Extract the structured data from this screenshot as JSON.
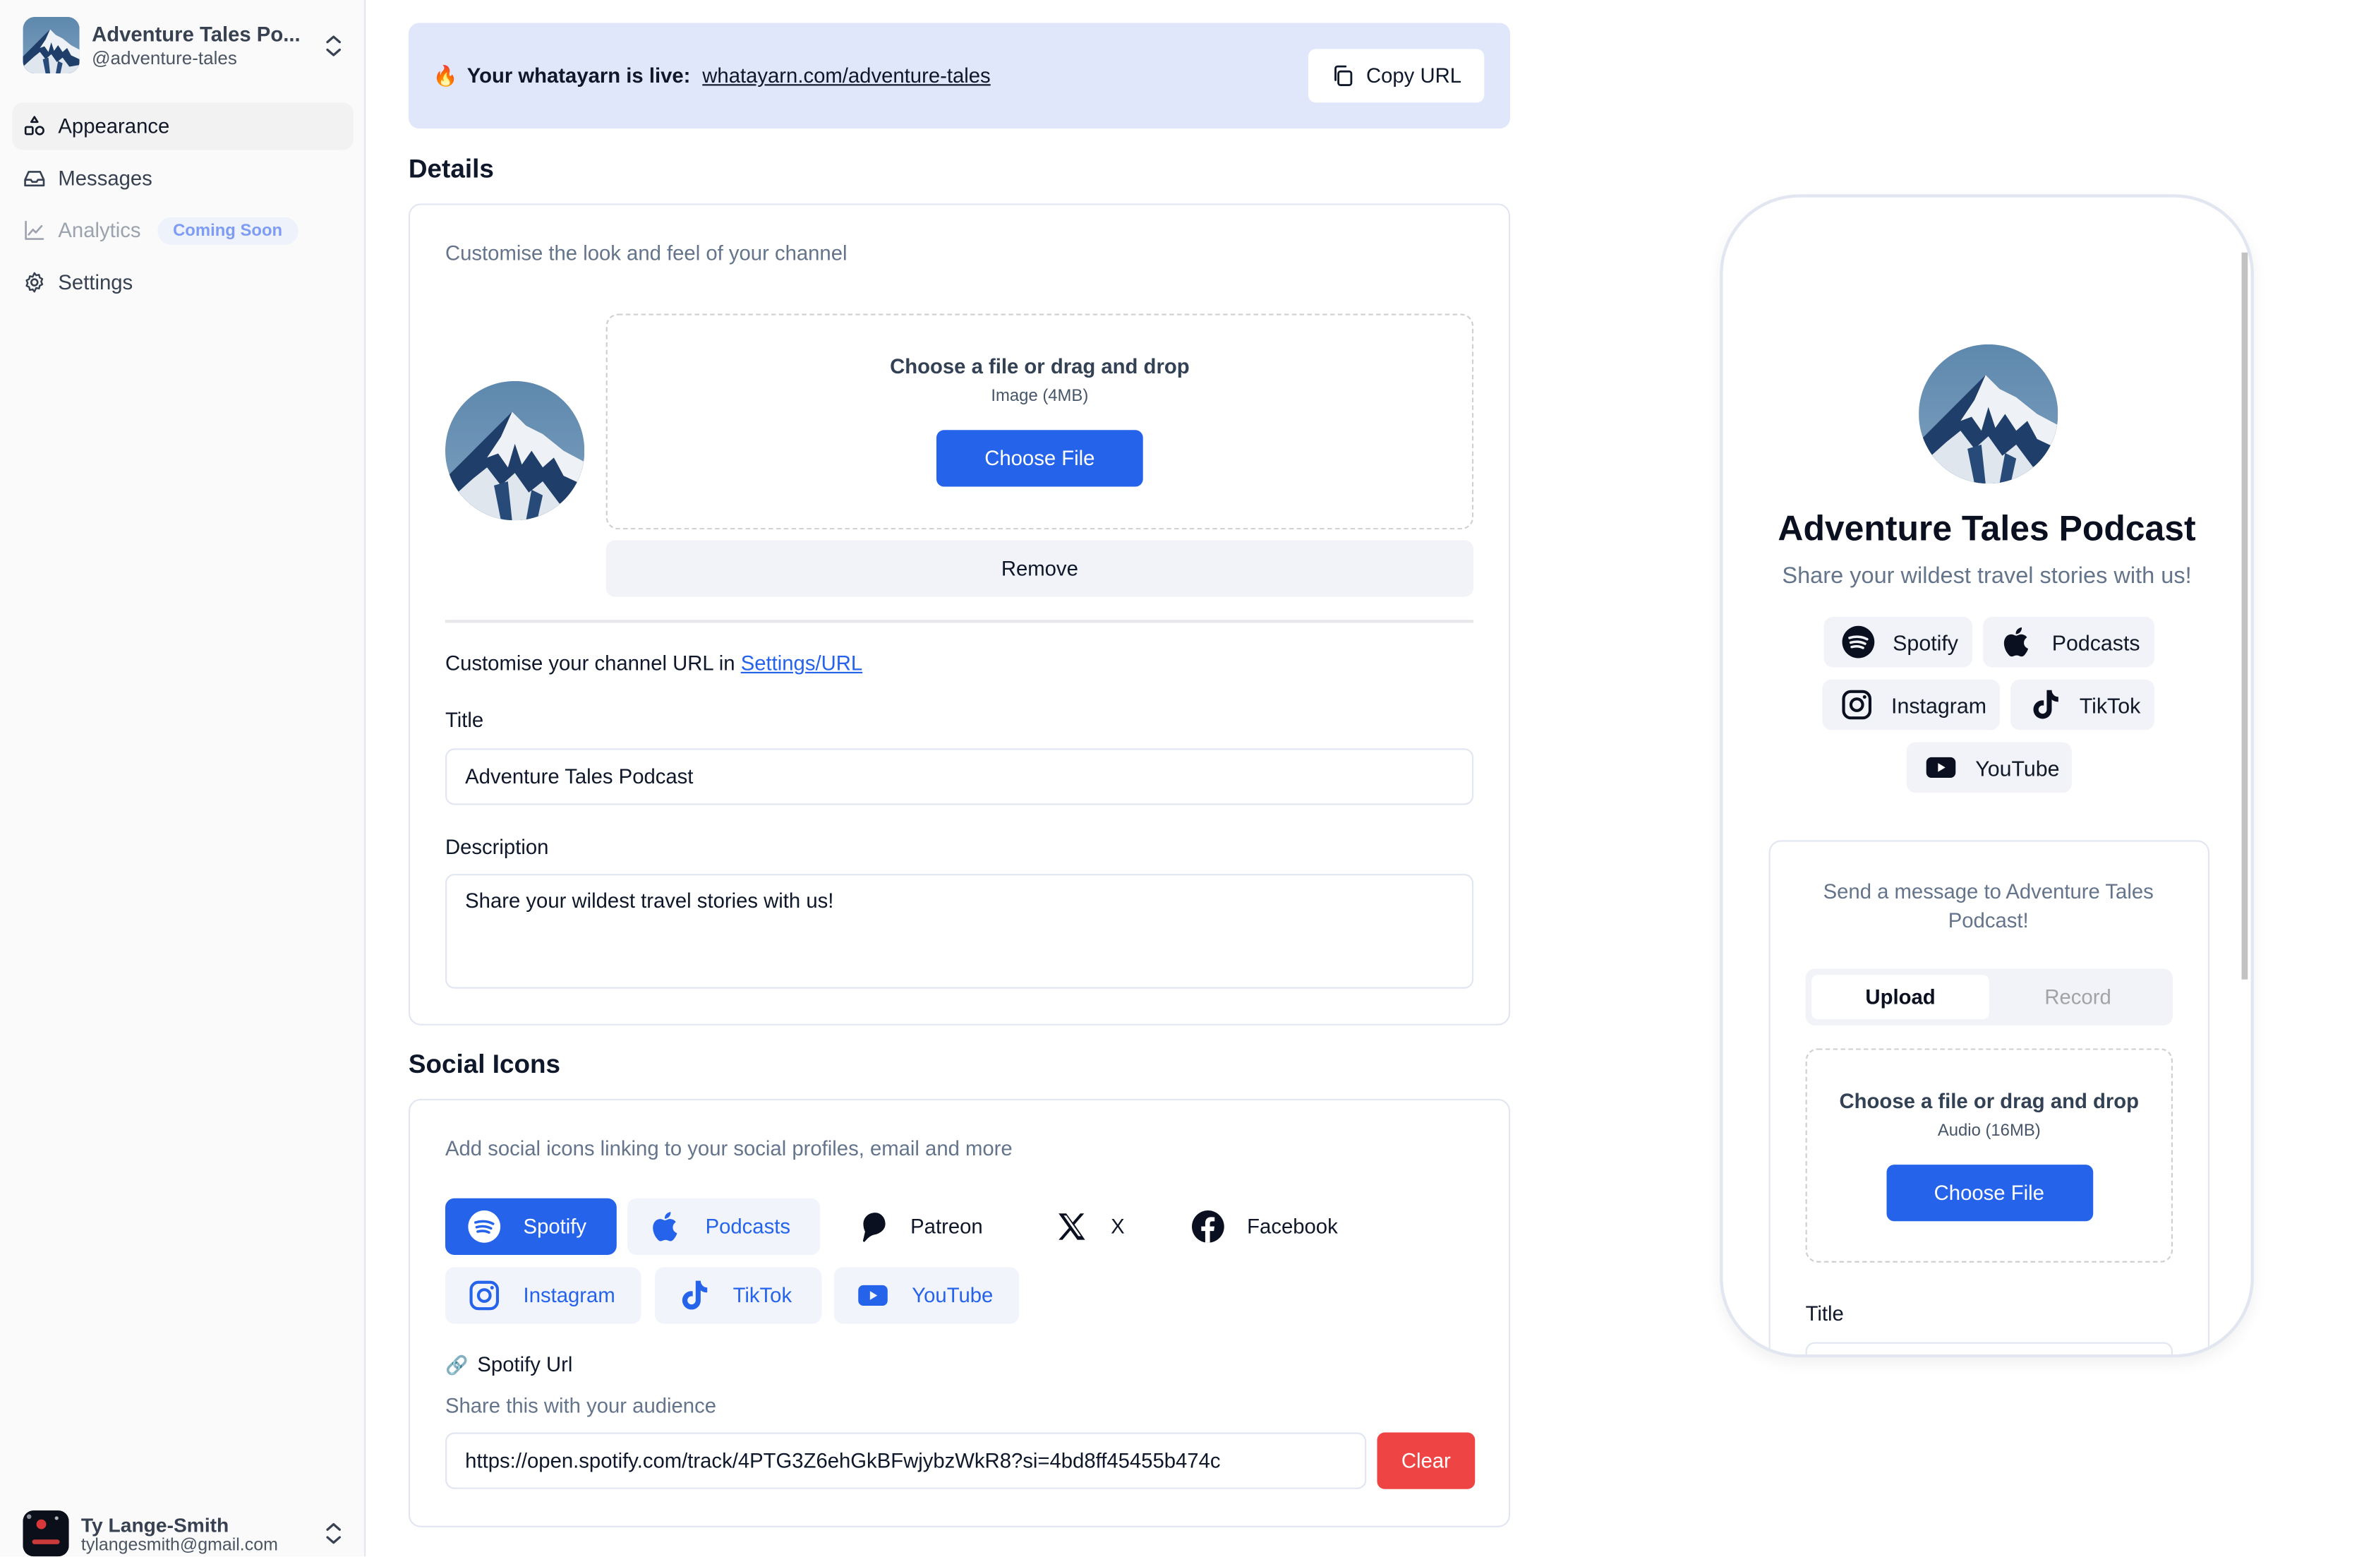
{
  "account": {
    "name": "Adventure Tales Po...",
    "handle": "@adventure-tales"
  },
  "nav": [
    {
      "label": "Appearance",
      "icon": "shapes-icon",
      "active": true
    },
    {
      "label": "Messages",
      "icon": "inbox-icon"
    },
    {
      "label": "Analytics",
      "icon": "chart-line-icon",
      "disabled": true,
      "badge": "Coming Soon"
    },
    {
      "label": "Settings",
      "icon": "gear-icon"
    }
  ],
  "user": {
    "name": "Ty Lange-Smith",
    "email": "tylangesmith@gmail.com"
  },
  "banner": {
    "emoji": "🔥",
    "text": "Your whatayarn is live:",
    "link": "whatayarn.com/adventure-tales",
    "copy_label": "Copy URL",
    "background": "#e0e7fb"
  },
  "details": {
    "heading": "Details",
    "subtitle": "Customise the look and feel of your channel",
    "dropzone": {
      "title": "Choose a file or drag and drop",
      "subtitle": "Image (4MB)",
      "button": "Choose File"
    },
    "remove_label": "Remove",
    "url_hint_prefix": "Customise your channel URL in",
    "url_hint_link": "Settings/URL",
    "title_label": "Title",
    "title_value": "Adventure Tales Podcast",
    "description_label": "Description",
    "description_value": "Share your wildest travel stories with us!"
  },
  "social": {
    "heading": "Social Icons",
    "subtitle": "Add social icons linking to your social profiles, email and more",
    "icons": [
      {
        "label": "Spotify",
        "state": "selected"
      },
      {
        "label": "Podcasts",
        "state": "added"
      },
      {
        "label": "Patreon",
        "state": "available"
      },
      {
        "label": "X",
        "state": "available"
      },
      {
        "label": "Facebook",
        "state": "available"
      },
      {
        "label": "Instagram",
        "state": "added"
      },
      {
        "label": "TikTok",
        "state": "added"
      },
      {
        "label": "YouTube",
        "state": "added"
      }
    ],
    "url_label": "Spotify Url",
    "url_hint": "Share this with your audience",
    "url_value": "https://open.spotify.com/track/4PTG3Z6ehGkBFwjybzWkR8?si=4bd8ff45455b474c",
    "clear_label": "Clear"
  },
  "preview": {
    "title": "Adventure Tales Podcast",
    "description": "Share your wildest travel stories with us!",
    "chips": [
      "Spotify",
      "Podcasts",
      "Instagram",
      "TikTok",
      "YouTube"
    ],
    "message_prompt": "Send a message to Adventure Tales Podcast!",
    "tabs": [
      "Upload",
      "Record"
    ],
    "active_tab": "Upload",
    "dropzone": {
      "title": "Choose a file or drag and drop",
      "subtitle": "Audio (16MB)",
      "button": "Choose File"
    },
    "title_label": "Title"
  },
  "colors": {
    "primary": "#2563eb",
    "danger": "#ef4444",
    "badge_text": "#7f9cf5"
  }
}
